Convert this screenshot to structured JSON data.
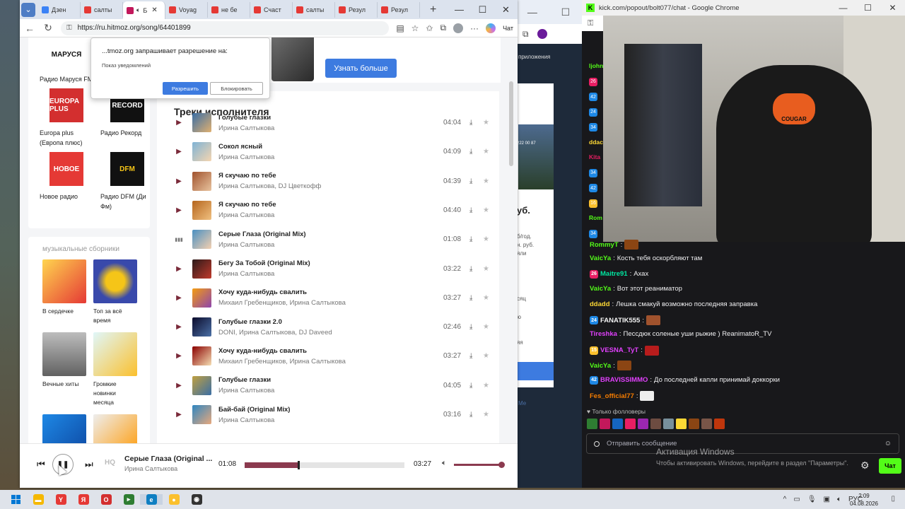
{
  "browser": {
    "tabs": [
      {
        "label": "Дзен",
        "color": "#3b82f6"
      },
      {
        "label": "салты",
        "color": "#e53935"
      },
      {
        "label": "Б",
        "color": "#c2185b",
        "active": true
      },
      {
        "label": "Voyag",
        "color": "#e53935"
      },
      {
        "label": "не бе",
        "color": "#e53935"
      },
      {
        "label": "Счаст",
        "color": "#e53935"
      },
      {
        "label": "салты",
        "color": "#e53935"
      },
      {
        "label": "Резул",
        "color": "#e53935"
      },
      {
        "label": "Резул",
        "color": "#e53935"
      }
    ],
    "url": "https://ru.hitmoz.org/song/64401899",
    "chat_label": "Чат"
  },
  "permission": {
    "title": "...tmoz.org запрашивает разрешение на:",
    "desc": "Показ уведомлений",
    "allow": "Разрешить",
    "block": "Блокировать"
  },
  "banner": {
    "button": "Узнать больше"
  },
  "radios": [
    {
      "name": "Радио Маруся FM",
      "logo": "МАРУСЯ",
      "bg": "#ffffff",
      "fg": "#111111"
    },
    {
      "name": "",
      "logo": "",
      "bg": "#ffffff",
      "fg": "#111111"
    },
    {
      "name": "Europa plus (Европа плюс)",
      "logo": "EUROPA PLUS",
      "bg": "#d32f2f",
      "fg": "#ffffff"
    },
    {
      "name": "Радио Рекорд",
      "logo": "RECORD",
      "bg": "#111111",
      "fg": "#ffffff"
    },
    {
      "name": "Новое радио",
      "logo": "НОВОЕ",
      "bg": "#e53935",
      "fg": "#ffffff"
    },
    {
      "name": "Радио DFM (Ди Фм)",
      "logo": "DFM",
      "bg": "#111111",
      "fg": "#f5c518"
    }
  ],
  "collections": {
    "title": "музыкальные сборники",
    "items": [
      {
        "name": "В сердечке",
        "bg": "linear-gradient(135deg,#ffd54f,#e53935)"
      },
      {
        "name": "Топ за всё время",
        "bg": "radial-gradient(circle,#f5c518 30%,#3949ab 60%)"
      },
      {
        "name": "Вечные хиты",
        "bg": "linear-gradient(180deg,#bdbdbd,#616161)"
      },
      {
        "name": "Громкие новинки месяца",
        "bg": "linear-gradient(135deg,#e0f7fa,#fbc02d)"
      },
      {
        "name": "",
        "bg": "linear-gradient(135deg,#1e88e5,#0d47a1)"
      },
      {
        "name": "",
        "bg": "linear-gradient(135deg,#eeeeee,#ff9800)"
      }
    ]
  },
  "tracks_title": "Треки исполнителя",
  "tracks": [
    {
      "title": "Голубые глазки",
      "artist": "Ирина Салтыкова",
      "duration": "04:04",
      "cover": "linear-gradient(135deg,#3a6ea5,#e0b070)"
    },
    {
      "title": "Сокол ясный",
      "artist": "Ирина Салтыкова",
      "duration": "04:09",
      "cover": "linear-gradient(135deg,#7fb3d5,#f5d5b0)"
    },
    {
      "title": "Я скучаю по тебе",
      "artist": "Ирина Салтыкова, DJ Цветкофф",
      "duration": "04:39",
      "cover": "linear-gradient(135deg,#a0522d,#e8c39e)"
    },
    {
      "title": "Я скучаю по тебе",
      "artist": "Ирина Салтыкова",
      "duration": "04:40",
      "cover": "linear-gradient(135deg,#b5651d,#f0c080)"
    },
    {
      "title": "Серые Глаза (Original Mix)",
      "artist": "Ирина Салтыкова",
      "duration": "01:08",
      "cover": "linear-gradient(135deg,#4a90c2,#f4d0b0)",
      "playing": true
    },
    {
      "title": "Бегу За Тобой (Original Mix)",
      "artist": "Ирина Салтыкова",
      "duration": "03:22",
      "cover": "linear-gradient(135deg,#2b1a1a,#c0392b)"
    },
    {
      "title": "Хочу куда-нибудь свалить",
      "artist": "Михаил Гребенщиков, Ирина Салтыкова",
      "duration": "03:27",
      "cover": "linear-gradient(135deg,#f39c12,#8e44ad)"
    },
    {
      "title": "Голубые глазки 2.0",
      "artist": "DONI, Ирина Салтыкова, DJ Daveed",
      "duration": "02:46",
      "cover": "linear-gradient(135deg,#0b0b2b,#4a6fa5)"
    },
    {
      "title": "Хочу куда-нибудь свалить",
      "artist": "Михаил Гребенщиков, Ирина Салтыкова",
      "duration": "03:27",
      "cover": "linear-gradient(135deg,#8b0000,#f5deb3)"
    },
    {
      "title": "Голубые глазки",
      "artist": "Ирина Салтыкова",
      "duration": "04:05",
      "cover": "linear-gradient(135deg,#c0a040,#3a6ea5)"
    },
    {
      "title": "Бай-бай (Original Mix)",
      "artist": "Ирина Салтыкова",
      "duration": "03:16",
      "cover": "linear-gradient(135deg,#2e86c1,#e8a87c)"
    }
  ],
  "player": {
    "hq": "HQ",
    "title": "Серые Глаза (Original ...",
    "artist": "Ирина Салтыкова",
    "current": "01:08",
    "total": "03:27",
    "progress": 0.33,
    "volume": 1.0
  },
  "bg_window": {
    "apps": "приложения",
    "price": "уб.",
    "phone": "222 00 87",
    "note1": "б/год.",
    "note2": "н. руб.",
    "note3": "яли",
    "m1": "сяц",
    "m2": "ю",
    "m3": "яя",
    "link": "Ме"
  },
  "chat": {
    "window_title": "kick.com/popout/bolt077/chat - Google Chrome",
    "strip": [
      {
        "name": "ljohn",
        "color": "#53fc18"
      },
      {
        "name": "26",
        "color": "#e91e63",
        "badge": true
      },
      {
        "name": "42",
        "color": "#1e88e5",
        "badge": true
      },
      {
        "name": "24",
        "color": "#1e88e5",
        "badge": true
      },
      {
        "name": "34",
        "color": "#1e88e5",
        "badge": true
      },
      {
        "name": "ddac",
        "color": "#fdd835"
      },
      {
        "name": "Kita",
        "color": "#e91e63"
      },
      {
        "name": "34",
        "color": "#1e88e5",
        "badge": true
      },
      {
        "name": "42",
        "color": "#1e88e5",
        "badge": true
      },
      {
        "name": "16",
        "color": "#fbc02d",
        "badge": true
      },
      {
        "name": "Rom",
        "color": "#53fc18"
      },
      {
        "name": "34",
        "color": "#1e88e5",
        "badge": true
      }
    ],
    "messages": [
      {
        "user": "RommyT",
        "color": "#53fc18",
        "text": "",
        "emote": "#8b4513"
      },
      {
        "user": "VaicYa",
        "color": "#53fc18",
        "text": "Кость тебя оскорбляют там"
      },
      {
        "user": "Maitre91",
        "color": "#00e5a0",
        "text": "Ахах",
        "badge": "26",
        "badge_color": "#e91e63"
      },
      {
        "user": "VaicYa",
        "color": "#53fc18",
        "text": "Вот этот реаниматор"
      },
      {
        "user": "ddadd",
        "color": "#fdd835",
        "text": "Лешка смакуй возможно последняя заправка"
      },
      {
        "user": "FANATIK555",
        "color": "#f5f5f5",
        "text": "",
        "badge": "24",
        "badge_color": "#1e88e5",
        "emote": "#a0522d"
      },
      {
        "user": "Tireshka",
        "color": "#e040fb",
        "text": "Пессдюк соленые уши рыжие ) ReanimatoR_TV"
      },
      {
        "user": "VESNA_TyT",
        "color": "#e040fb",
        "text": "",
        "badge": "15",
        "badge_color": "#fbc02d",
        "emote": "#b71c1c"
      },
      {
        "user": "VaicYa",
        "color": "#53fc18",
        "text": "",
        "emote": "#8b4513"
      },
      {
        "user": "BRAVISSIMMO",
        "color": "#e040fb",
        "text": "До последней капли принимай доккорки",
        "badge": "42",
        "badge_color": "#1e88e5"
      },
      {
        "user": "Fes_official77",
        "color": "#f57c00",
        "text": "",
        "emote": "#eeeeee"
      }
    ],
    "followers": "Только фолловеры",
    "emotes": [
      "#2e7d32",
      "#c2185b",
      "#1565c0",
      "#e91e63",
      "#9c27b0",
      "#6d4c41",
      "#78909c",
      "#fdd835",
      "#8b4513",
      "#795548",
      "#bf360c"
    ],
    "input_placeholder": "Отправить сообщение",
    "send": "Чат"
  },
  "watermark": {
    "line1": "Активация Windows",
    "line2": "Чтобы активировать Windows, перейдите в раздел \"Параметры\"."
  },
  "taskbar": {
    "apps": [
      {
        "name": "file-explorer-icon",
        "glyph": "▬",
        "color": "#f5b800"
      },
      {
        "name": "yandex-icon",
        "glyph": "Y",
        "color": "#e53935"
      },
      {
        "name": "yandex-browser-icon",
        "glyph": "Я",
        "color": "#e53935"
      },
      {
        "name": "opera-icon",
        "glyph": "O",
        "color": "#d32f2f"
      },
      {
        "name": "terminal-icon",
        "glyph": "▸",
        "color": "#2e7d32"
      },
      {
        "name": "edge-icon",
        "glyph": "e",
        "color": "#0f7fc2"
      },
      {
        "name": "chrome-icon",
        "glyph": "●",
        "color": "#fbc02d"
      },
      {
        "name": "obs-icon",
        "glyph": "◉",
        "color": "#333333"
      }
    ],
    "lang": "РУС",
    "time": "2:09",
    "date": "04.08.2026"
  }
}
